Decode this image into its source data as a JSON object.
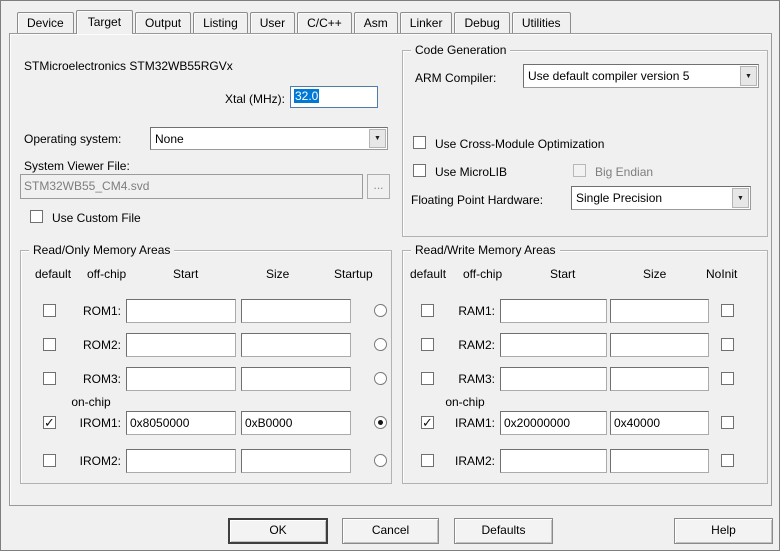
{
  "tabs": {
    "items": [
      "Device",
      "Target",
      "Output",
      "Listing",
      "User",
      "C/C++",
      "Asm",
      "Linker",
      "Debug",
      "Utilities"
    ],
    "active": "Target"
  },
  "page": {
    "device_line": "STMicroelectronics STM32WB55RGVx",
    "xtal_label": "Xtal (MHz):",
    "xtal_value": "32.0",
    "os_label": "Operating system:",
    "os_value": "None",
    "svd_label": "System Viewer File:",
    "svd_value": "STM32WB55_CM4.svd",
    "svd_browse": "...",
    "custom_file_label": "Use Custom File",
    "custom_file_checked": false,
    "codegen": {
      "title": "Code Generation",
      "compiler_label": "ARM Compiler:",
      "compiler_value": "Use default compiler version 5",
      "cross_module_label": "Use Cross-Module Optimization",
      "cross_module_checked": false,
      "microlib_label": "Use MicroLIB",
      "microlib_checked": false,
      "big_endian_label": "Big Endian",
      "big_endian_checked": false,
      "fpu_label": "Floating Point Hardware:",
      "fpu_value": "Single Precision"
    },
    "rom": {
      "title": "Read/Only Memory Areas",
      "headers": [
        "default",
        "off-chip",
        "Start",
        "Size",
        "Startup"
      ],
      "onchip": "on-chip",
      "rows": [
        {
          "label": "ROM1:",
          "default": false,
          "start": "",
          "size": "",
          "startup": false
        },
        {
          "label": "ROM2:",
          "default": false,
          "start": "",
          "size": "",
          "startup": false
        },
        {
          "label": "ROM3:",
          "default": false,
          "start": "",
          "size": "",
          "startup": false
        },
        {
          "label": "IROM1:",
          "default": true,
          "start": "0x8050000",
          "size": "0xB0000",
          "startup": true
        },
        {
          "label": "IROM2:",
          "default": false,
          "start": "",
          "size": "",
          "startup": false
        }
      ]
    },
    "ram": {
      "title": "Read/Write Memory Areas",
      "headers": [
        "default",
        "off-chip",
        "Start",
        "Size",
        "NoInit"
      ],
      "onchip": "on-chip",
      "rows": [
        {
          "label": "RAM1:",
          "default": false,
          "start": "",
          "size": "",
          "noinit": false
        },
        {
          "label": "RAM2:",
          "default": false,
          "start": "",
          "size": "",
          "noinit": false
        },
        {
          "label": "RAM3:",
          "default": false,
          "start": "",
          "size": "",
          "noinit": false
        },
        {
          "label": "IRAM1:",
          "default": true,
          "start": "0x20000000",
          "size": "0x40000",
          "noinit": false
        },
        {
          "label": "IRAM2:",
          "default": false,
          "start": "",
          "size": "",
          "noinit": false
        }
      ]
    }
  },
  "buttons": {
    "ok": "OK",
    "cancel": "Cancel",
    "defaults": "Defaults",
    "help": "Help"
  },
  "colors": {
    "dialog_bg": "#f0f0f0",
    "selection": "#0078d7"
  }
}
